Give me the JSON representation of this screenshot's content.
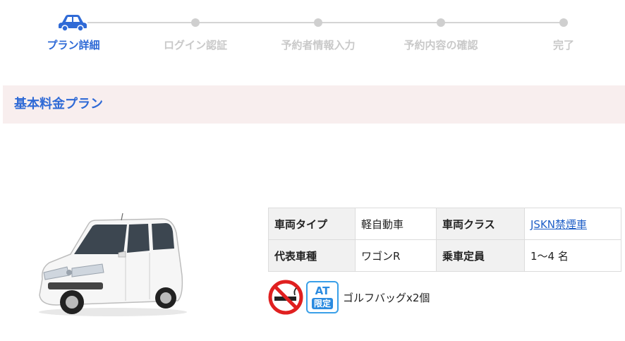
{
  "stepper": {
    "steps": [
      {
        "label": "プラン詳細",
        "active": true
      },
      {
        "label": "ログイン認証",
        "active": false
      },
      {
        "label": "予約者情報入力",
        "active": false
      },
      {
        "label": "予約内容の確認",
        "active": false
      },
      {
        "label": "完了",
        "active": false
      }
    ],
    "active_color": "#2f6ad6",
    "inactive_color": "#c9c9c9",
    "current_icon": "car-icon"
  },
  "section": {
    "title": "基本料金プラン",
    "background": "#f8eeee"
  },
  "vehicle": {
    "image": "suzuki-wagon-r-white"
  },
  "spec_table": {
    "rows": [
      [
        {
          "label": "車両タイプ",
          "value": "軽自動車"
        },
        {
          "label": "車両クラス",
          "value": "JSKN禁煙車",
          "link": true
        }
      ],
      [
        {
          "label": "代表車種",
          "value": "ワゴンR"
        },
        {
          "label": "乗車定員",
          "value": "1～4 名"
        }
      ]
    ]
  },
  "features": {
    "icons": [
      "no-smoking-icon",
      "at-only-icon"
    ],
    "at_badge": {
      "top": "AT",
      "bottom": "限定"
    },
    "text": "ゴルフバッグx2個"
  }
}
